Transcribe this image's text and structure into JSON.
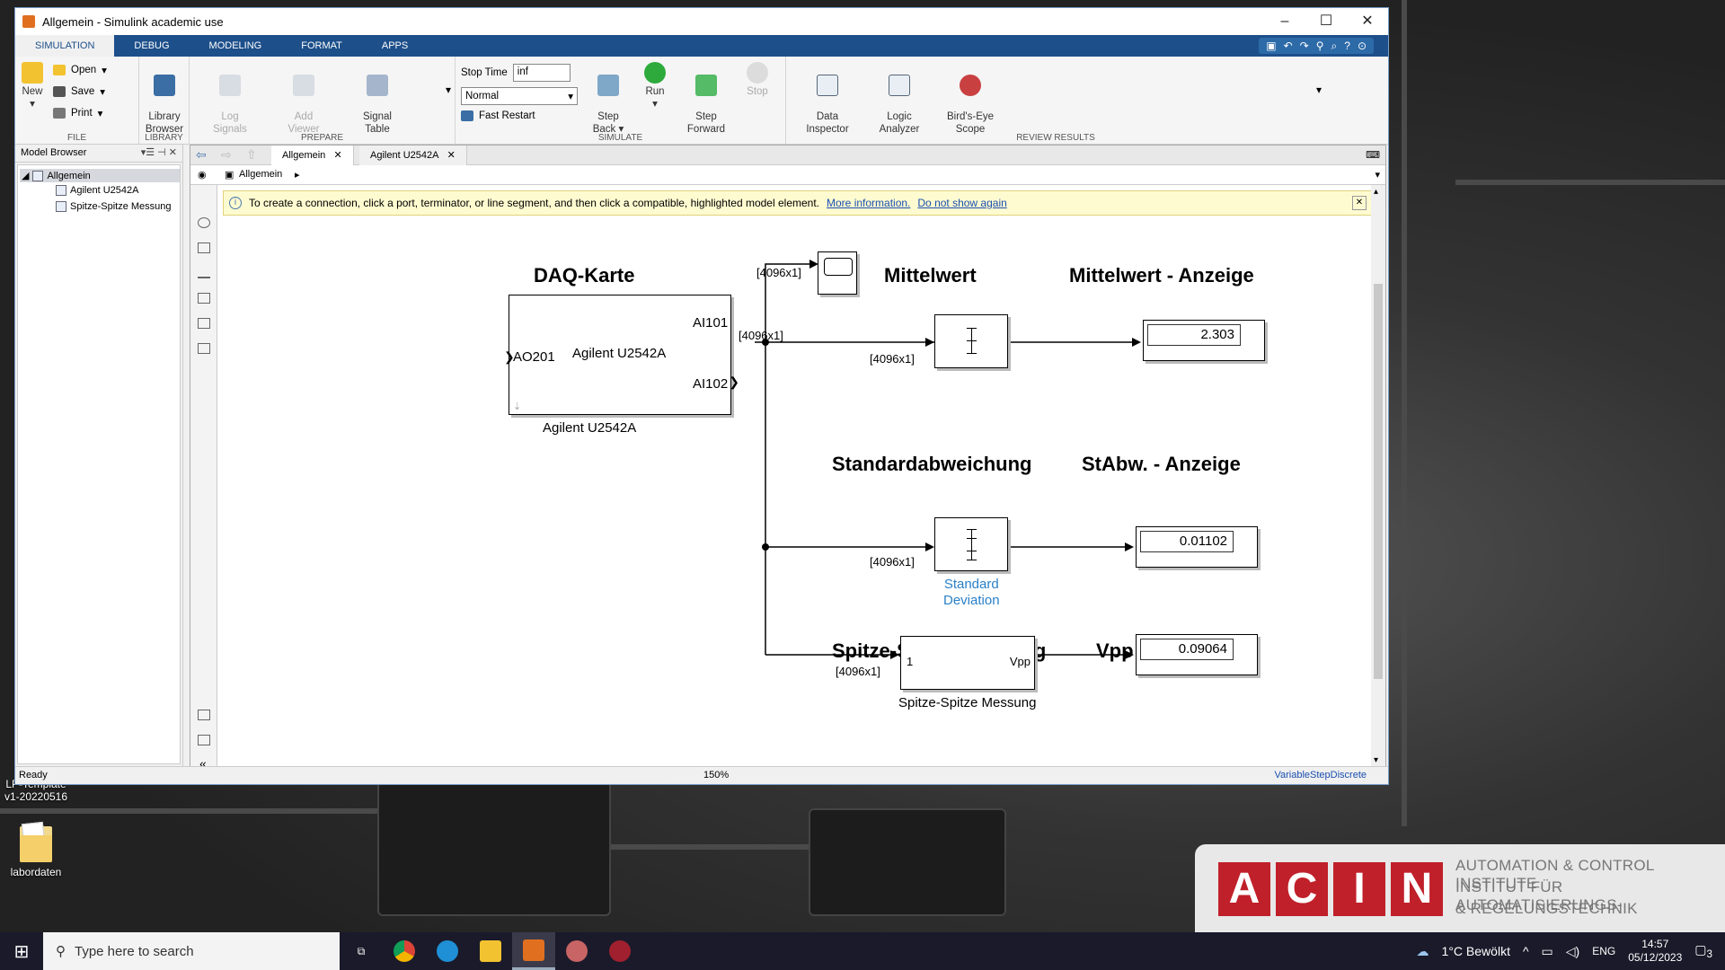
{
  "window": {
    "title": "Allgemein - Simulink academic use"
  },
  "ribbon_tabs": [
    "SIMULATION",
    "DEBUG",
    "MODELING",
    "FORMAT",
    "APPS"
  ],
  "ribbon": {
    "file": {
      "new": "New",
      "open": "Open",
      "save": "Save",
      "print": "Print",
      "label": "FILE"
    },
    "library": {
      "browser": "Library\nBrowser",
      "label": "LIBRARY"
    },
    "prepare": {
      "log_signals": "Log\nSignals",
      "add_viewer": "Add\nViewer",
      "signal_table": "Signal\nTable",
      "label": "PREPARE"
    },
    "simulate": {
      "stop_time_label": "Stop Time",
      "stop_time_value": "inf",
      "mode": "Normal",
      "fast_restart": "Fast Restart",
      "step_back": "Step\nBack",
      "run": "Run",
      "step_forward": "Step\nForward",
      "stop": "Stop",
      "label": "SIMULATE"
    },
    "review": {
      "data_inspector": "Data\nInspector",
      "logic_analyzer": "Logic\nAnalyzer",
      "birds_eye": "Bird's-Eye\nScope",
      "label": "REVIEW RESULTS"
    }
  },
  "model_browser": {
    "title": "Model Browser",
    "items": [
      "Allgemein",
      "Agilent U2542A",
      "Spitze-Spitze Messung"
    ]
  },
  "editor_tabs": [
    "Allgemein",
    "Agilent U2542A"
  ],
  "breadcrumb": "Allgemein",
  "infobar": {
    "text": "To create a connection, click a port, terminator, or line segment, and then click a compatible, highlighted model element.",
    "link1": "More information.",
    "link2": "Do not show again"
  },
  "diagram": {
    "titles": {
      "daq": "DAQ-Karte",
      "mittelwert": "Mittelwert",
      "mittelwert_anzeige": "Mittelwert - Anzeige",
      "std": "Standardabweichung",
      "std_anzeige": "StAbw. - Anzeige",
      "vpp": "Spitze-Spitze Messung",
      "vpp_anzeige": "Vpp - Anzeige"
    },
    "daq_block": {
      "name": "Agilent U2542A",
      "caption": "Agilent U2542A",
      "in_port": "AO201",
      "out1": "AI101",
      "out2": "AI102"
    },
    "signal_dim": "[4096x1]",
    "std_caption": "Standard\nDeviation",
    "vpp_block": {
      "in_port": "1",
      "out_port": "Vpp",
      "caption": "Spitze-Spitze Messung"
    },
    "displays": {
      "mean": "2.303",
      "std": "0.01102",
      "vpp": "0.09064"
    }
  },
  "status": {
    "left": "Ready",
    "zoom": "150%",
    "solver": "VariableStepDiscrete"
  },
  "desktop": {
    "icon1": "LP-Template\nv1-20220516",
    "icon2": "labordaten",
    "logo_letters": [
      "A",
      "C",
      "I",
      "N"
    ],
    "logo_lines": [
      "AUTOMATION & CONTROL INSTITUTE",
      "INSTITUT FÜR AUTOMATISIERUNGS-",
      "& REGELUNGSTECHNIK"
    ]
  },
  "taskbar": {
    "search_placeholder": "Type here to search",
    "weather": "1°C  Bewölkt",
    "lang": "ENG",
    "time": "14:57",
    "date": "05/12/2023",
    "notifications": "3"
  }
}
